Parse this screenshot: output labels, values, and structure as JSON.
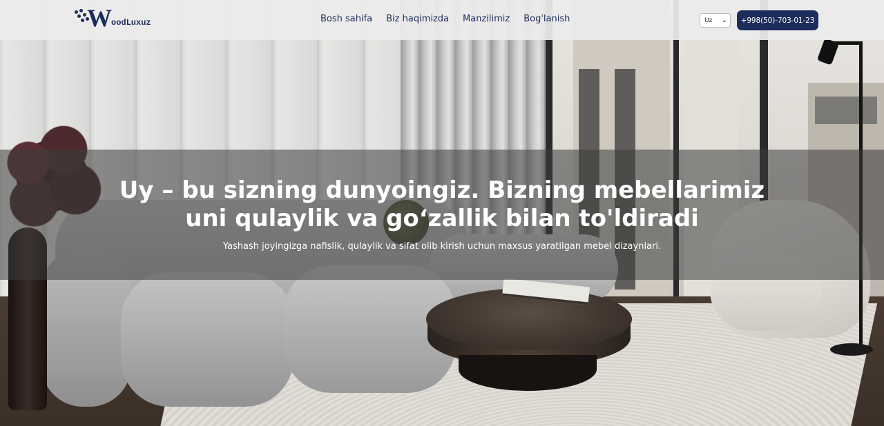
{
  "header": {
    "logo_text": "oodLuxuz",
    "logo_letter": "W",
    "nav": [
      {
        "label": "Bosh sahifa"
      },
      {
        "label": "Biz haqimizda"
      },
      {
        "label": "Manzilimiz"
      },
      {
        "label": "Bog'lanish"
      }
    ],
    "language": {
      "selected": "Uz"
    },
    "phone": "+998(50)-703-01-23"
  },
  "hero": {
    "title_line1": "Uy – bu sizning dunyoingiz. Bizning mebellarimiz",
    "title_line2": "uni qulaylik va go‘zallik bilan to'ldiradi",
    "subtitle": "Yashash joyingizga nafislik, qulaylik va sifat olib kirish uchun maxsus yaratilgan mebel dizaynlari."
  },
  "colors": {
    "brand_navy": "#1c2c5b",
    "header_bg": "#ececec",
    "hero_overlay": "#3c3c3c"
  },
  "icons": [
    "chevron-down-icon"
  ]
}
